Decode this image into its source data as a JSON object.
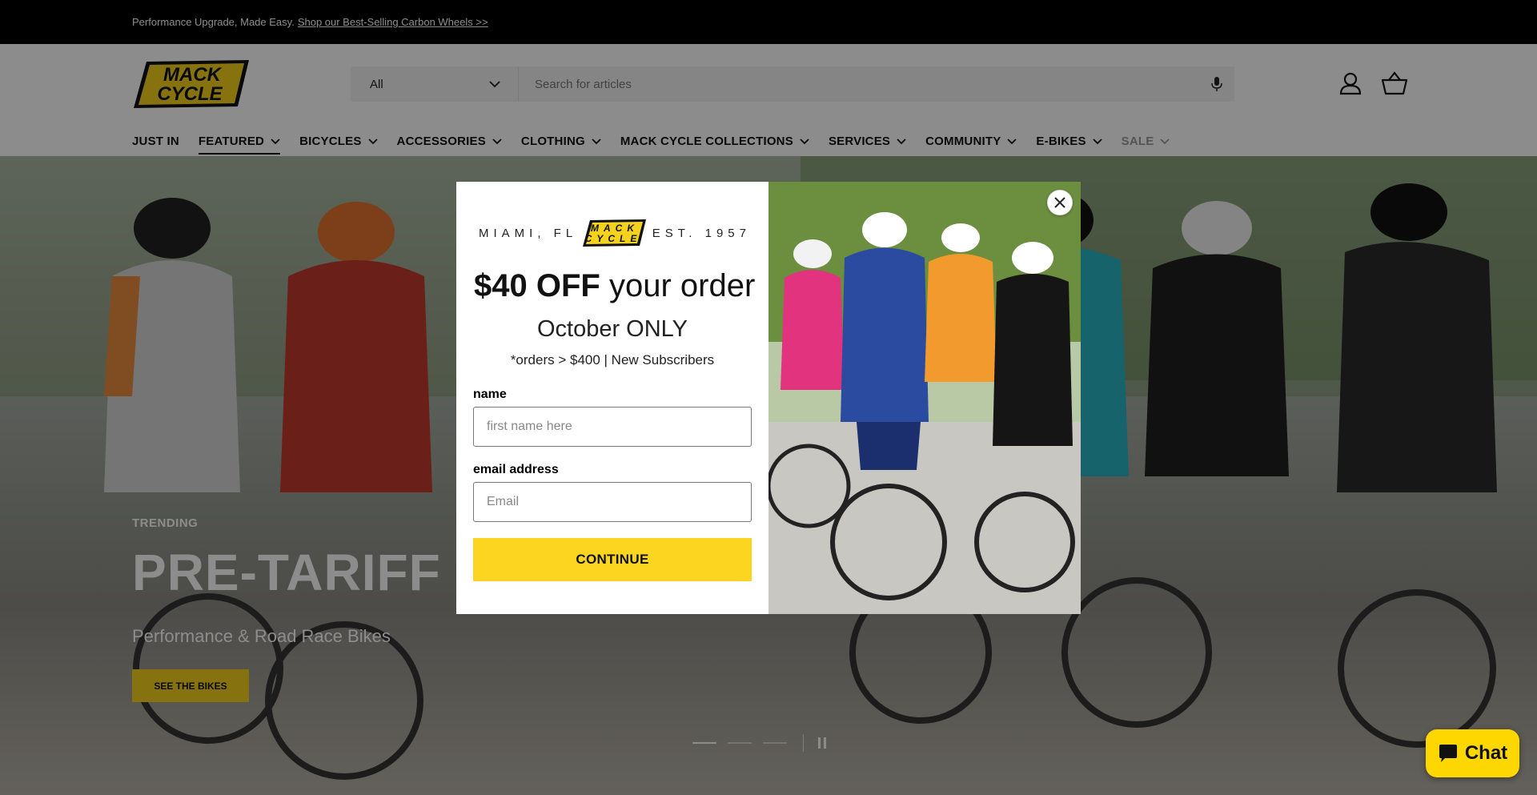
{
  "announcement": {
    "text": "Performance Upgrade, Made Easy.",
    "link": "Shop our Best-Selling Carbon Wheels >>"
  },
  "header": {
    "logo": {
      "line1": "MACK",
      "line2": "CYCLE"
    },
    "search": {
      "category": "All",
      "placeholder": "Search for articles"
    },
    "icons": [
      "account-icon",
      "cart-icon"
    ]
  },
  "nav": {
    "items": [
      {
        "label": "JUST IN",
        "has_menu": false
      },
      {
        "label": "FEATURED",
        "has_menu": true,
        "active": true
      },
      {
        "label": "BICYCLES",
        "has_menu": true
      },
      {
        "label": "ACCESSORIES",
        "has_menu": true
      },
      {
        "label": "CLOTHING",
        "has_menu": true
      },
      {
        "label": "MACK CYCLE COLLECTIONS",
        "has_menu": true
      },
      {
        "label": "SERVICES",
        "has_menu": true
      },
      {
        "label": "COMMUNITY",
        "has_menu": true
      },
      {
        "label": "E-BIKES",
        "has_menu": true
      },
      {
        "label": "SALE",
        "has_menu": true
      }
    ]
  },
  "hero": {
    "eyebrow": "TRENDING",
    "title": "PRE-TARIFF RO",
    "subtitle": "Performance & Road Race Bikes",
    "button": "SEE THE BIKES",
    "slides": 3,
    "active_slide": 1
  },
  "modal": {
    "brand_left": "MIAMI, FL",
    "brand_right": "EST. 1957",
    "offer_bold": "$40 OFF",
    "offer_rest": " your order",
    "month": "October ONLY",
    "terms": "*orders > $400 | New Subscribers",
    "name_label": "name",
    "name_placeholder": "first name here",
    "email_label": "email address",
    "email_placeholder": "Email",
    "submit": "CONTINUE"
  },
  "chat": {
    "label": "Chat"
  },
  "colors": {
    "brand_yellow": "#fbd51f",
    "announcement_bg": "#000000",
    "overlay": "rgba(0,0,0,0.45)"
  }
}
